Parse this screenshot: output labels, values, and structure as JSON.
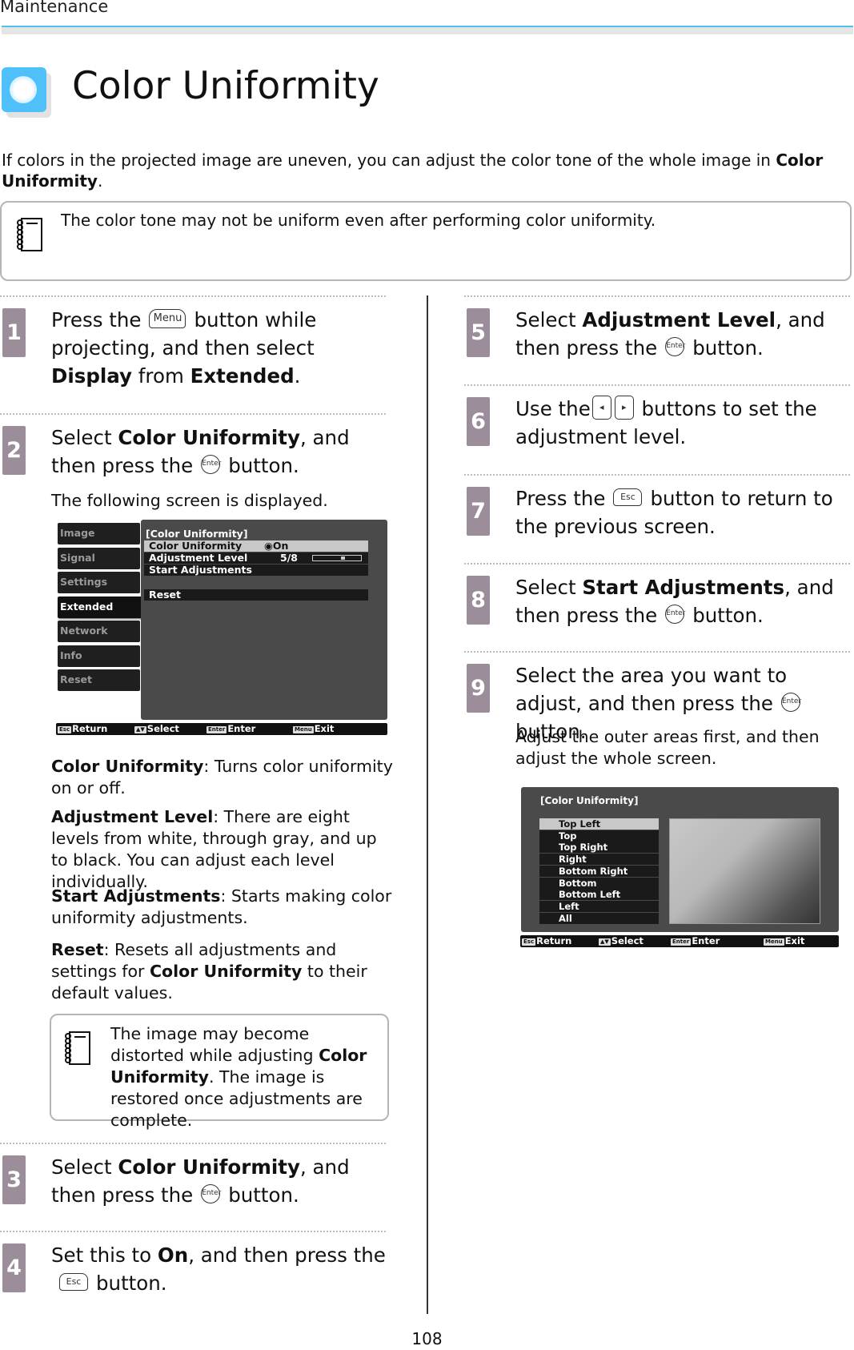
{
  "header": {
    "section": "Maintenance",
    "title": "Color Uniformity"
  },
  "intro": [
    {
      "t": "If colors in the projected image are uneven, you can adjust the color tone of the whole image in "
    },
    {
      "t": "Color Uniformity",
      "b": true
    },
    {
      "t": "."
    }
  ],
  "note1": "The color tone may not be uniform even after performing color uniformity.",
  "steps": [
    {
      "num": "1",
      "text": [
        {
          "t": "Press the"
        },
        {
          "k": "menu",
          "label": "Menu"
        },
        {
          "t": "button while projecting, and then select "
        },
        {
          "t": "Display",
          "b": true
        },
        {
          "t": " from "
        },
        {
          "t": "Extended",
          "b": true
        },
        {
          "t": "."
        }
      ]
    },
    {
      "num": "2",
      "text": [
        {
          "t": "Select "
        },
        {
          "t": "Color Uniformity",
          "b": true
        },
        {
          "t": ", and then press the"
        },
        {
          "k": "enter",
          "label": "Enter"
        },
        {
          "t": "button."
        }
      ],
      "sub": "The following screen is displayed."
    },
    {
      "num": "3",
      "text": [
        {
          "t": "Select "
        },
        {
          "t": "Color Uniformity",
          "b": true
        },
        {
          "t": ", and then press the"
        },
        {
          "k": "enter",
          "label": "Enter"
        },
        {
          "t": "button."
        }
      ]
    },
    {
      "num": "4",
      "text": [
        {
          "t": "Set this to "
        },
        {
          "t": "On",
          "b": true
        },
        {
          "t": ", and then press the"
        },
        {
          "k": "esc",
          "label": "Esc"
        },
        {
          "t": "button."
        }
      ]
    },
    {
      "num": "5",
      "text": [
        {
          "t": "Select "
        },
        {
          "t": "Adjustment Level",
          "b": true
        },
        {
          "t": ", and then press the"
        },
        {
          "k": "enter",
          "label": "Enter"
        },
        {
          "t": "button."
        }
      ]
    },
    {
      "num": "6",
      "text": [
        {
          "t": "Use the"
        },
        {
          "k": "lr",
          "label": "◂"
        },
        {
          "k": "lr",
          "label": "▸"
        },
        {
          "t": " buttons to set the adjustment level."
        }
      ]
    },
    {
      "num": "7",
      "text": [
        {
          "t": "Press the"
        },
        {
          "k": "esc",
          "label": "Esc"
        },
        {
          "t": "button to return to the previous screen."
        }
      ]
    },
    {
      "num": "8",
      "text": [
        {
          "t": "Select "
        },
        {
          "t": "Start Adjustments",
          "b": true
        },
        {
          "t": ", and then press the"
        },
        {
          "k": "enter",
          "label": "Enter"
        },
        {
          "t": "button."
        }
      ]
    },
    {
      "num": "9",
      "text": [
        {
          "t": "Select the area you want to adjust, and then press the"
        },
        {
          "k": "enter",
          "label": "Enter"
        },
        {
          "t": "button."
        }
      ],
      "sub": "Adjust the outer areas first, and then adjust the whole screen."
    }
  ],
  "descriptions": [
    [
      {
        "t": "Color Uniformity",
        "b": true
      },
      {
        "t": ": Turns color uniformity on or off."
      }
    ],
    [
      {
        "t": "Adjustment Level",
        "b": true
      },
      {
        "t": ": There are eight levels from white, through gray, and up to black. You can adjust each level individually."
      }
    ],
    [
      {
        "t": "Start Adjustments",
        "b": true
      },
      {
        "t": ": Starts making color uniformity adjustments."
      }
    ],
    [
      {
        "t": "Reset",
        "b": true
      },
      {
        "t": ": Resets all adjustments and settings for "
      },
      {
        "t": "Color Uniformity",
        "b": true
      },
      {
        "t": " to their default values."
      }
    ]
  ],
  "note2": [
    {
      "t": "The image may become distorted while adjusting "
    },
    {
      "t": "Color Uniformity",
      "b": true
    },
    {
      "t": ". The image is restored once adjustments are complete."
    }
  ],
  "menu1": {
    "tabs": [
      "Image",
      "Signal",
      "Settings",
      "Extended",
      "Network",
      "Info",
      "Reset"
    ],
    "selected_tab": "Extended",
    "panel_title": "[Color Uniformity]",
    "rows": [
      {
        "label": "Color Uniformity",
        "value": "On"
      },
      {
        "label": "Adjustment Level",
        "value": "5/8"
      },
      {
        "label": "Start Adjustments"
      },
      {
        "label": "Reset"
      }
    ],
    "level": 0.625
  },
  "menu2": {
    "panel_title": "[Color Uniformity]",
    "areas": [
      "Top Left",
      "Top",
      "Top Right",
      "Right",
      "Bottom Right",
      "Bottom",
      "Bottom Left",
      "Left",
      "All"
    ],
    "selected": "Top Left"
  },
  "footer": [
    {
      "key": "Esc",
      "label": "Return"
    },
    {
      "key": "▲▼",
      "label": "Select"
    },
    {
      "key": "Enter",
      "label": "Enter"
    },
    {
      "key": "Menu",
      "label": "Exit"
    }
  ],
  "page_number": "108",
  "colors": {
    "accent": "#4fc3f0",
    "badge": "#9b8e9a"
  }
}
